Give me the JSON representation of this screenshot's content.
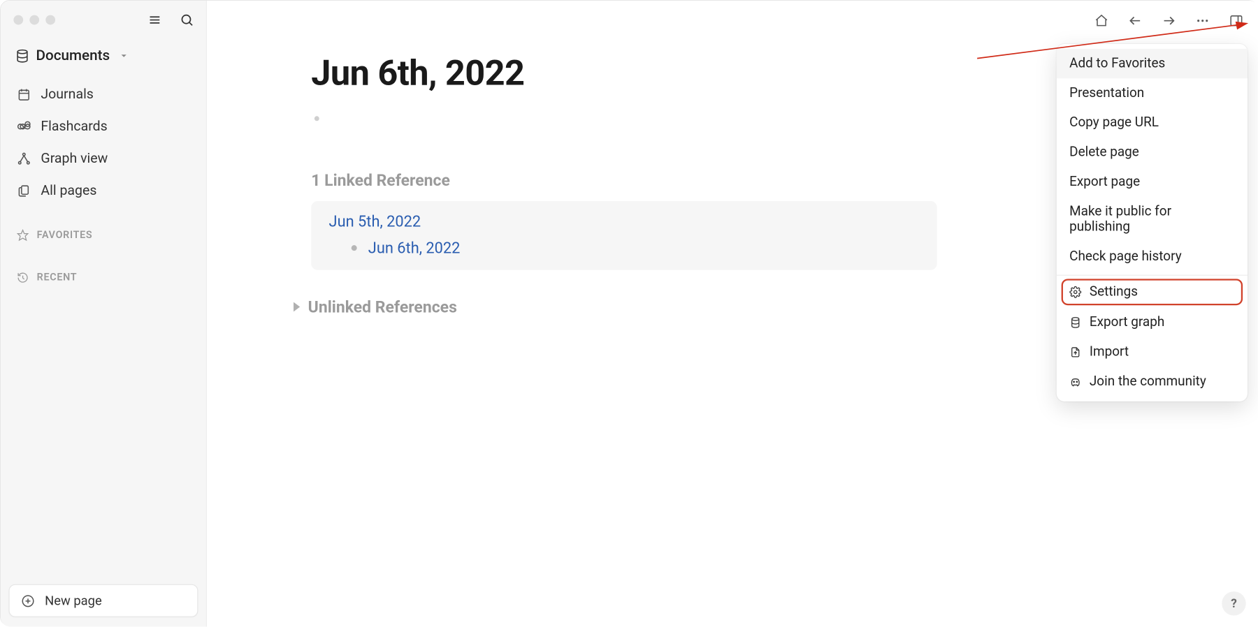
{
  "sidebar": {
    "graph_name": "Documents",
    "nav": {
      "journals": "Journals",
      "flashcards": "Flashcards",
      "graph_view": "Graph view",
      "all_pages": "All pages"
    },
    "favorites_label": "FAVORITES",
    "recent_label": "RECENT",
    "new_page_label": "New page"
  },
  "page": {
    "title": "Jun 6th, 2022",
    "linked_ref_header": "1 Linked Reference",
    "linked_ref": {
      "page": "Jun 5th, 2022",
      "child": "Jun 6th, 2022"
    },
    "unlinked_header": "Unlinked References"
  },
  "menu": {
    "add_favorites": "Add to Favorites",
    "presentation": "Presentation",
    "copy_url": "Copy page URL",
    "delete_page": "Delete page",
    "export_page": "Export page",
    "make_public": "Make it public for publishing",
    "check_history": "Check page history",
    "settings": "Settings",
    "export_graph": "Export graph",
    "import": "Import",
    "community": "Join the community"
  },
  "help": "?"
}
